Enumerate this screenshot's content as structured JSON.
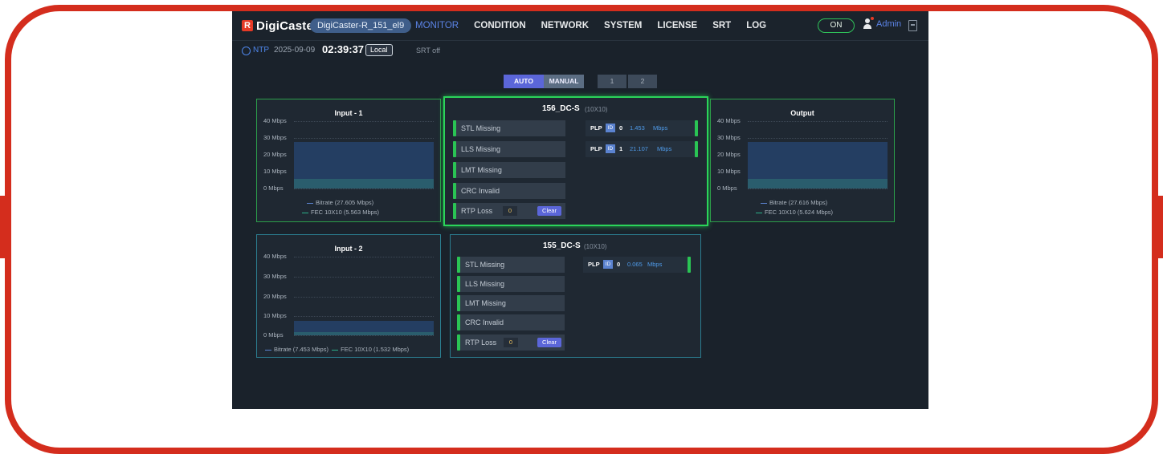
{
  "header": {
    "logo_mark": "R",
    "logo_text": "DigiCaster",
    "device_name": "DigiCaster-R_151_el9",
    "nav": [
      "MONITOR",
      "CONDITION",
      "NETWORK",
      "SYSTEM",
      "LICENSE",
      "SRT",
      "LOG"
    ],
    "active_nav": "MONITOR",
    "power_toggle": "ON",
    "user": "Admin"
  },
  "status": {
    "ntp_label": "NTP",
    "date": "2025-09-09",
    "time": "02:39:37",
    "local_label": "Local",
    "srt_status": "SRT off"
  },
  "mode": {
    "auto": "AUTO",
    "manual": "MANUAL",
    "selected": "AUTO",
    "pages": [
      "1",
      "2"
    ]
  },
  "y_ticks": [
    "40 Mbps",
    "30 Mbps",
    "20 Mbps",
    "10 Mbps",
    "0 Mbps"
  ],
  "input1": {
    "title": "Input - 1",
    "legend_bitrate": "Bitrate (27.605 Mbps)",
    "legend_fec": "FEC 10X10 (5.563 Mbps)",
    "bitrate_mbps": 27.605,
    "fec_mbps": 5.563
  },
  "input2": {
    "title": "Input - 2",
    "legend_bitrate": "Bitrate (7.453 Mbps)",
    "legend_fec": "FEC 10X10 (1.532 Mbps)",
    "bitrate_mbps": 7.453,
    "fec_mbps": 1.532
  },
  "output": {
    "title": "Output",
    "legend_bitrate": "Bitrate (27.616 Mbps)",
    "legend_fec": "FEC 10X10 (5.624 Mbps)",
    "bitrate_mbps": 27.616,
    "fec_mbps": 5.624
  },
  "stream1": {
    "name": "156_DC-S",
    "fec": "(10X10)",
    "rows": [
      "STL Missing",
      "LLS Missing",
      "LMT Missing",
      "CRC Invalid"
    ],
    "rtp_label": "RTP Loss",
    "rtp_value": "0",
    "clear_label": "Clear",
    "plps": [
      {
        "label": "PLP",
        "id_label": "ID",
        "id": "0",
        "value": "1.453",
        "unit": "Mbps"
      },
      {
        "label": "PLP",
        "id_label": "ID",
        "id": "1",
        "value": "21.107",
        "unit": "Mbps"
      }
    ]
  },
  "stream2": {
    "name": "155_DC-S",
    "fec": "(10X10)",
    "rows": [
      "STL Missing",
      "LLS Missing",
      "LMT Missing",
      "CRC Invalid"
    ],
    "rtp_label": "RTP Loss",
    "rtp_value": "0",
    "clear_label": "Clear",
    "plps": [
      {
        "label": "PLP",
        "id_label": "ID",
        "id": "0",
        "value": "0.065",
        "unit": "Mbps"
      }
    ]
  },
  "colors": {
    "frame": "#d42d1d",
    "bitrate_line": "#5b83d0",
    "fec_line": "#2bb08a",
    "ok_green": "#2ac454",
    "accent_blue": "#5b66d9"
  }
}
